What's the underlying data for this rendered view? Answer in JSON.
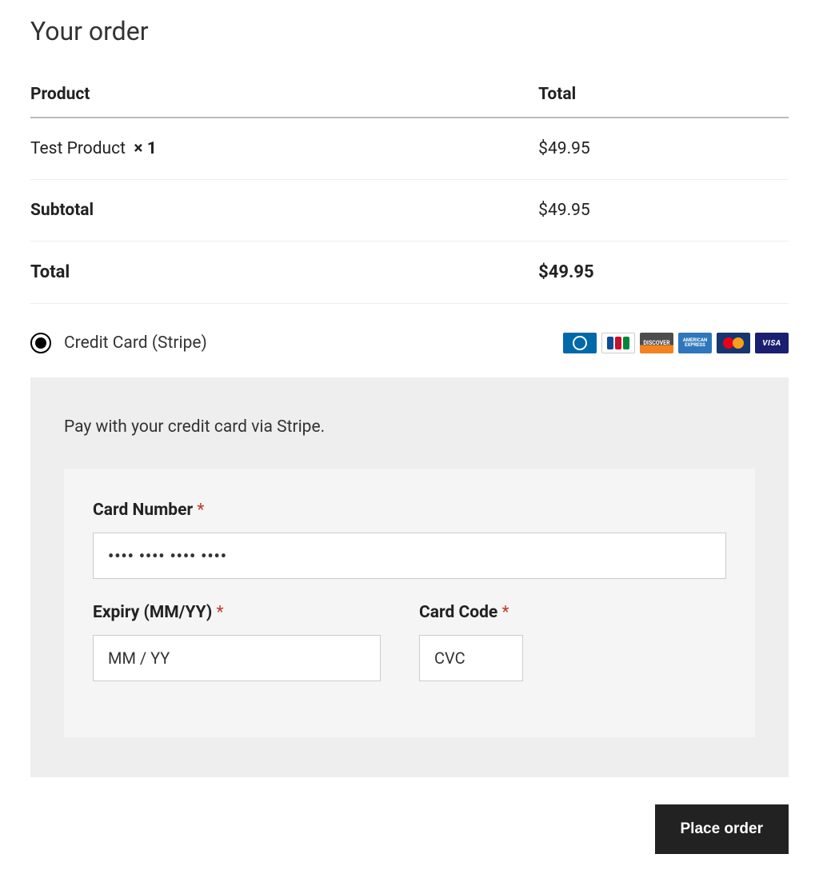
{
  "heading": "Your order",
  "table": {
    "headers": {
      "product": "Product",
      "total": "Total"
    },
    "items": [
      {
        "name": "Test Product",
        "qty_prefix": "× ",
        "qty": "1",
        "total": "$49.95"
      }
    ],
    "subtotal": {
      "label": "Subtotal",
      "value": "$49.95"
    },
    "total": {
      "label": "Total",
      "value": "$49.95"
    }
  },
  "payment": {
    "method_label": "Credit Card (Stripe)",
    "description": "Pay with your credit card via Stripe.",
    "card_number": {
      "label": "Card Number",
      "required": "*",
      "placeholder": "•••• •••• •••• ••••"
    },
    "expiry": {
      "label": "Expiry (MM/YY)",
      "required": "*",
      "placeholder": "MM / YY"
    },
    "cvc": {
      "label": "Card Code",
      "required": "*",
      "placeholder": "CVC"
    }
  },
  "actions": {
    "place_order": "Place order"
  }
}
